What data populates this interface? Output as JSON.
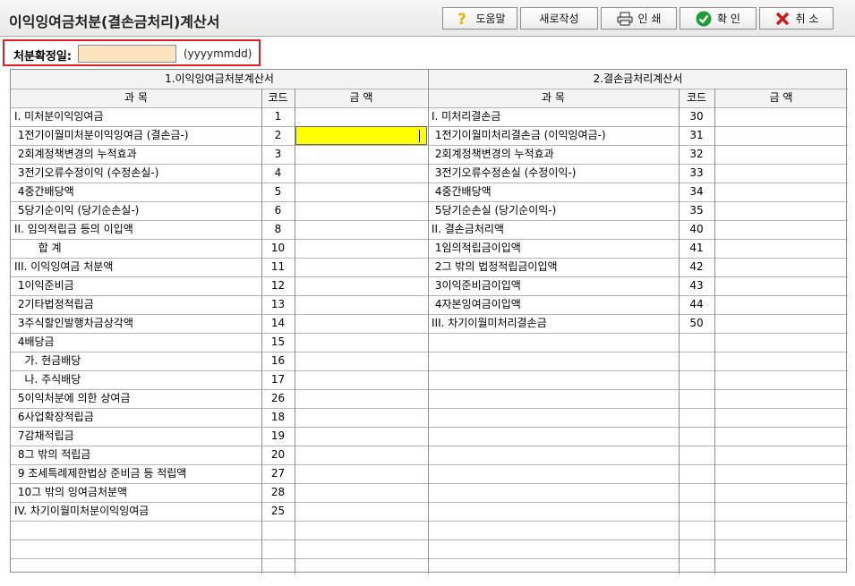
{
  "window": {
    "title": "이익잉여금처분(결손금처리)계산서"
  },
  "toolbar": {
    "help_label": "도움말",
    "new_label": "새로작성",
    "print_label": "인 쇄",
    "ok_label": "확 인",
    "cancel_label": "취 소",
    "colors": {
      "help_icon": "#e8b400",
      "ok_icon": "#1e9e35",
      "cancel_icon": "#d01818"
    }
  },
  "disposal_date": {
    "label": "처분확정일:",
    "value": "",
    "hint": "(yyyymmdd)",
    "highlight_color": "#e02020"
  },
  "left_section": {
    "title": "1.이익잉여금처분계산서",
    "col_subject": "과 목",
    "col_code": "코드",
    "col_amount": "금 액",
    "rows": [
      {
        "subject": "I. 미처분이익잉여금",
        "code": "1"
      },
      {
        "subject": " 1전기이월미처분이익잉여금 (결손금-)",
        "code": "2"
      },
      {
        "subject": " 2회계정책변경의 누적효과",
        "code": "3"
      },
      {
        "subject": " 3전기오류수정이익 (수정손실-)",
        "code": "4"
      },
      {
        "subject": " 4중간배당액",
        "code": "5"
      },
      {
        "subject": " 5당기순이익 (당기순손실-)",
        "code": "6"
      },
      {
        "subject": "II. 임의적립금 등의 이입액",
        "code": "8"
      },
      {
        "subject": "       합 계",
        "code": "10"
      },
      {
        "subject": "III. 이익잉여금 처분액",
        "code": "11"
      },
      {
        "subject": " 1이익준비금",
        "code": "12"
      },
      {
        "subject": " 2기타법정적립금",
        "code": "13"
      },
      {
        "subject": " 3주식할인발행차금상각액",
        "code": "14"
      },
      {
        "subject": " 4배당금",
        "code": "15"
      },
      {
        "subject": "   가. 현금배당",
        "code": "16"
      },
      {
        "subject": "   나. 주식배당",
        "code": "17"
      },
      {
        "subject": " 5이익처분에 의한 상여금",
        "code": "26"
      },
      {
        "subject": " 6사업확장적립금",
        "code": "18"
      },
      {
        "subject": " 7감채적립금",
        "code": "19"
      },
      {
        "subject": " 8그 밖의 적립금",
        "code": "20"
      },
      {
        "subject": " 9 조세특례제한법상 준비금 등 적립액",
        "code": "27"
      },
      {
        "subject": " 10그 밖의 잉여금처분액",
        "code": "28"
      },
      {
        "subject": "IV. 차기이월미처분이익잉여금",
        "code": "25"
      }
    ]
  },
  "right_section": {
    "title": "2.결손금처리계산서",
    "col_subject": "과 목",
    "col_code": "코드",
    "col_amount": "금 액",
    "rows": [
      {
        "subject": "I. 미처리결손금",
        "code": "30"
      },
      {
        "subject": " 1전기이월미처리결손금 (이익잉여금-)",
        "code": "31"
      },
      {
        "subject": " 2회계정책변경의 누적효과",
        "code": "32"
      },
      {
        "subject": " 3전기오류수정손실 (수정이익-)",
        "code": "33"
      },
      {
        "subject": " 4중간배당액",
        "code": "34"
      },
      {
        "subject": " 5당기순손실 (당기순이익-)",
        "code": "35"
      },
      {
        "subject": "II. 결손금처리액",
        "code": "40"
      },
      {
        "subject": " 1임의적립금이입액",
        "code": "41"
      },
      {
        "subject": " 2그 밖의 법정적립금이입액",
        "code": "42"
      },
      {
        "subject": " 3이익준비금이입액",
        "code": "43"
      },
      {
        "subject": " 4자본잉여금이입액",
        "code": "44"
      },
      {
        "subject": "III. 차기이월미처리결손금",
        "code": "50"
      }
    ]
  },
  "active_cell_color": "#ffff00"
}
